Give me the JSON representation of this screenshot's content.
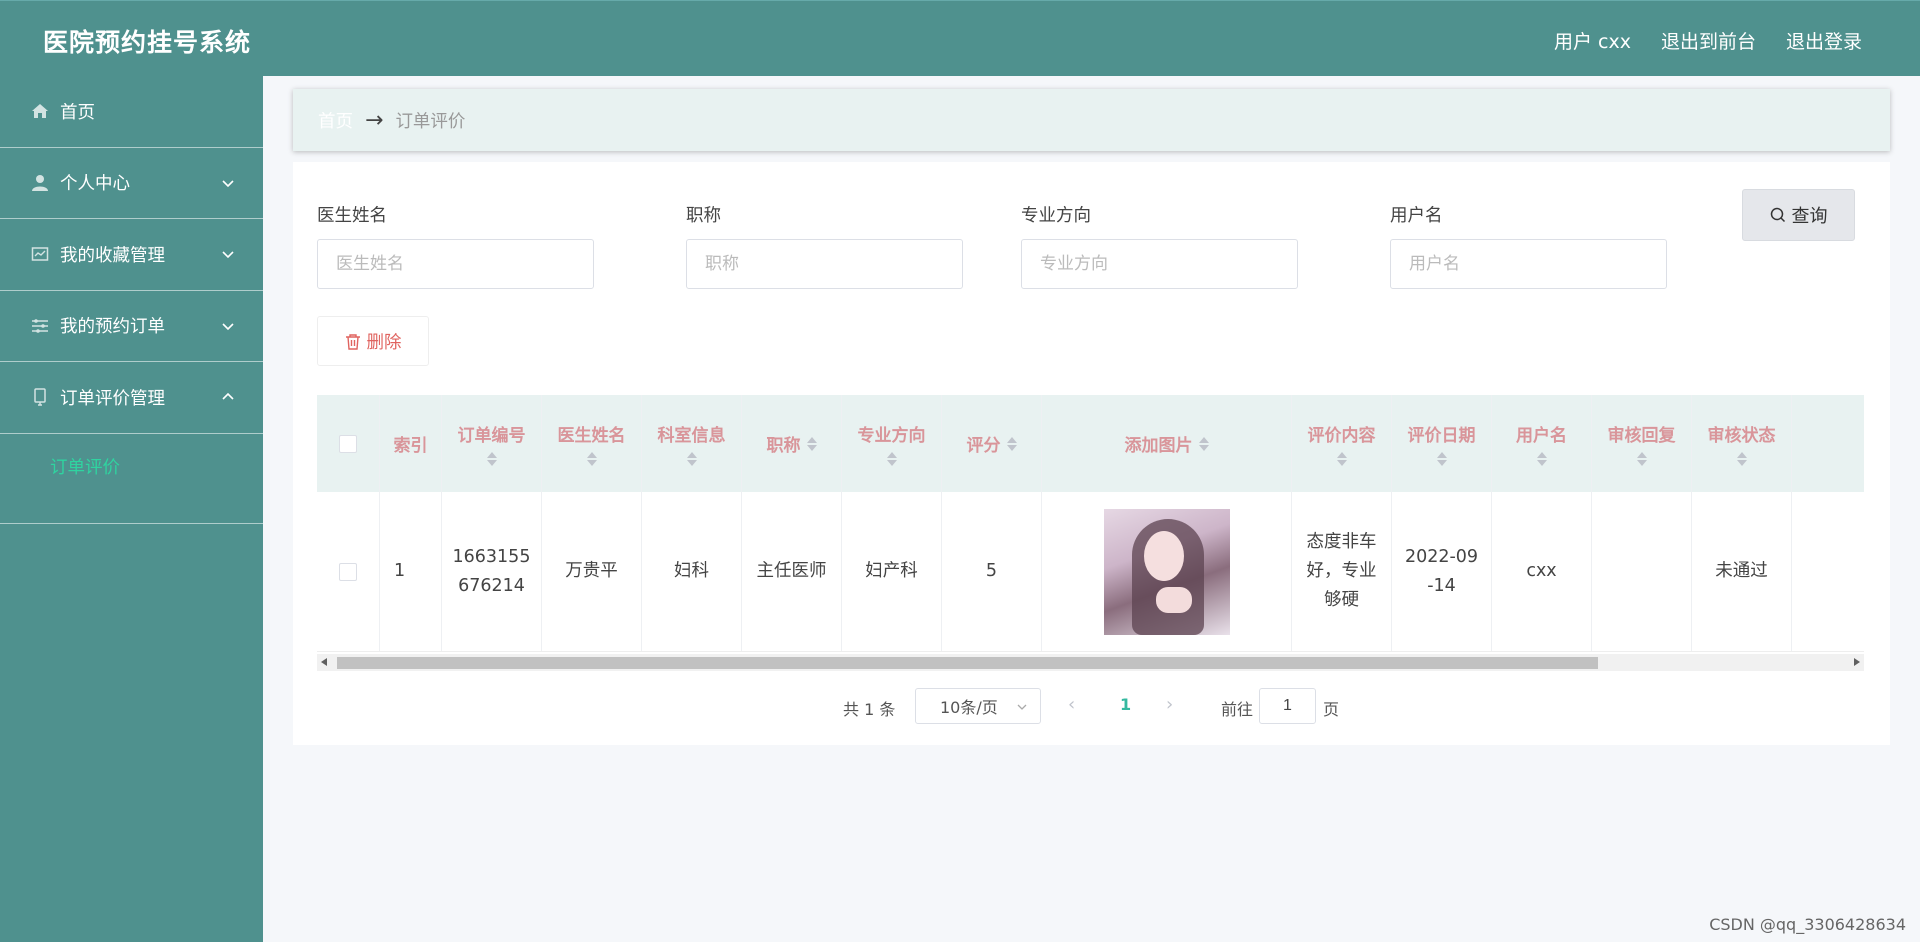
{
  "header": {
    "title": "医院预约挂号系统",
    "user": "用户 cxx",
    "back_front": "退出到前台",
    "logout": "退出登录"
  },
  "sidebar": {
    "items": [
      {
        "label": "首页",
        "icon": "home-icon"
      },
      {
        "label": "个人中心",
        "icon": "user-icon"
      },
      {
        "label": "我的收藏管理",
        "icon": "collection-icon"
      },
      {
        "label": "我的预约订单",
        "icon": "order-icon"
      },
      {
        "label": "订单评价管理",
        "icon": "review-icon"
      }
    ],
    "sub_item": "订单评价"
  },
  "breadcrumb": {
    "home": "首页",
    "arrow": "→",
    "current": "订单评价"
  },
  "search": {
    "doctor_label": "医生姓名",
    "doctor_placeholder": "医生姓名",
    "title_label": "职称",
    "title_placeholder": "职称",
    "specialty_label": "专业方向",
    "specialty_placeholder": "专业方向",
    "username_label": "用户名",
    "username_placeholder": "用户名",
    "query_button": "查询"
  },
  "actions": {
    "delete_button": "删除"
  },
  "table": {
    "columns": {
      "index": "索引",
      "order_no": "订单编号",
      "doctor": "医生姓名",
      "department": "科室信息",
      "title": "职称",
      "specialty": "专业方向",
      "score": "评分",
      "image": "添加图片",
      "content": "评价内容",
      "date": "评价日期",
      "username": "用户名",
      "reply": "审核回复",
      "status": "审核状态"
    },
    "rows": [
      {
        "index": "1",
        "order_no_line1": "1663155",
        "order_no_line2": "676214",
        "doctor": "万贵平",
        "department": "妇科",
        "title": "主任医师",
        "specialty": "妇产科",
        "score": "5",
        "content_line1": "态度非车",
        "content_line2": "好，专业",
        "content_line3": "够硬",
        "date_line1": "2022-09",
        "date_line2": "-14",
        "username": "cxx",
        "reply": "",
        "status": "未通过"
      }
    ]
  },
  "pagination": {
    "total": "共 1 条",
    "page_size": "10条/页",
    "current_page": "1",
    "goto_label": "前往",
    "goto_value": "1",
    "goto_suffix": "页"
  },
  "watermark": "CSDN @qq_3306428634",
  "colors": {
    "brand": "#4f918e",
    "accent": "#2fd4a0",
    "danger": "#e0635f",
    "header_text": "#d9959a"
  }
}
